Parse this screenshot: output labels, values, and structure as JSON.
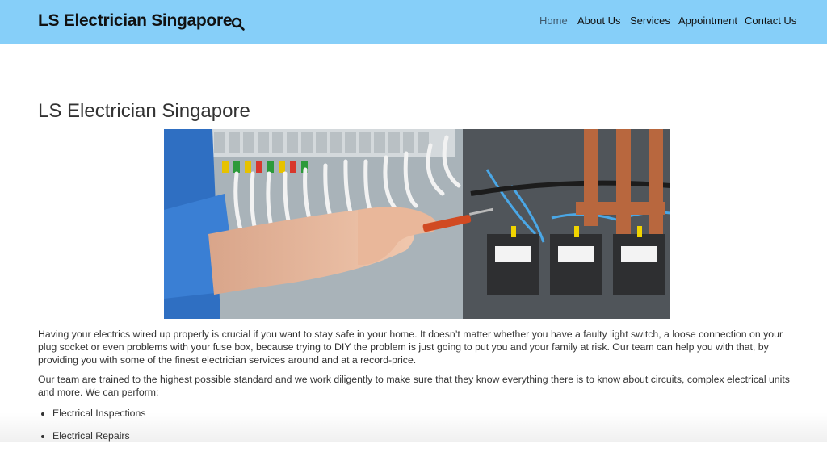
{
  "header": {
    "site_title": "LS Electrician Singapore",
    "search_icon": "search-icon",
    "bg_color": "#86cff9"
  },
  "nav": {
    "items": [
      {
        "label": "Home",
        "active": true
      },
      {
        "label": "About Us",
        "active": false
      },
      {
        "label": "Services",
        "active": false
      },
      {
        "label": "Appointment",
        "active": false
      },
      {
        "label": "Contact Us",
        "active": false
      }
    ]
  },
  "main": {
    "title": "LS Electrician Singapore",
    "paragraphs": [
      "Having your electrics wired up properly is crucial if you want to stay safe in your home. It doesn’t matter whether you have a faulty light switch, a loose connection on your plug socket or even problems with your fuse box, because trying to DIY the problem is just going to put you and your family at risk. Our team can help you with that, by providing you with some of the finest electrician services around and at a record-price.",
      "Our team are trained to the highest possible standard and we work diligently to make sure that they know everything there is to know about circuits, complex electrical units and more. We can perform:"
    ],
    "list": [
      "Electrical Inspections",
      "Electrical Repairs"
    ]
  }
}
